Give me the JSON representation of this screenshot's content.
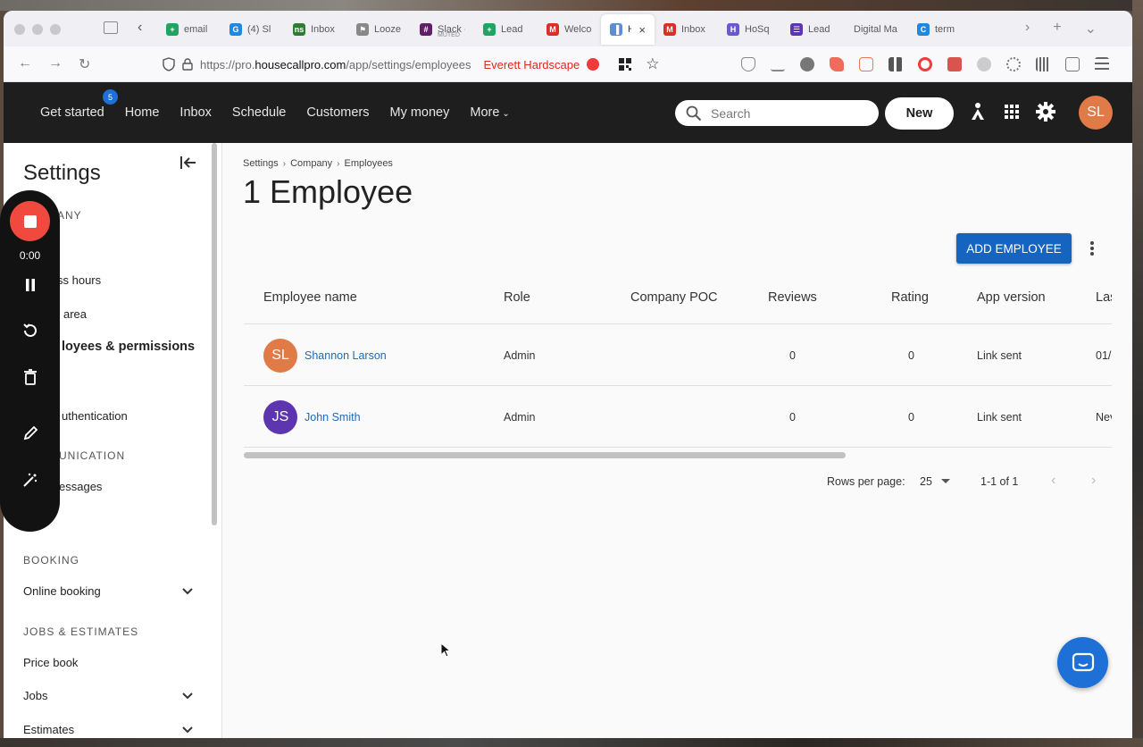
{
  "browser": {
    "tabs": [
      {
        "label": "email",
        "fav_color": "#1fa463",
        "fav_glyph": "+"
      },
      {
        "label": "(4) Sl",
        "fav_color": "#1e88e5",
        "fav_glyph": "G"
      },
      {
        "label": "Inbox",
        "fav_color": "#2e7d32",
        "fav_glyph": "ns"
      },
      {
        "label": "Looze",
        "fav_color": "#888888",
        "fav_glyph": "⚑"
      },
      {
        "label": "Slack -",
        "sublabel": "MUTED",
        "fav_color": "#611f69",
        "fav_glyph": "#"
      },
      {
        "label": "Lead",
        "fav_color": "#1fa463",
        "fav_glyph": "+"
      },
      {
        "label": "Welco",
        "fav_color": "#d93025",
        "fav_glyph": "M"
      },
      {
        "label": "Ho",
        "fav_color": "#5b8dd9",
        "fav_glyph": "▐"
      },
      {
        "label": "Inbox",
        "fav_color": "#d93025",
        "fav_glyph": "M"
      },
      {
        "label": "HoSq",
        "fav_color": "#6a5acd",
        "fav_glyph": "H"
      },
      {
        "label": "Lead",
        "fav_color": "#5e35b1",
        "fav_glyph": "☰"
      },
      {
        "label": "Digital Ma",
        "fav_color": "",
        "fav_glyph": ""
      },
      {
        "label": "term",
        "fav_color": "#1e88e5",
        "fav_glyph": "C"
      }
    ],
    "active_tab_index": 7,
    "url_prefix": "https://pro.",
    "url_domain": "housecallpro.com",
    "url_path": "/app/settings/employees",
    "extension_label": "Everett Hardscape"
  },
  "app": {
    "nav": [
      {
        "label": "Get started",
        "badge": "5"
      },
      {
        "label": "Home"
      },
      {
        "label": "Inbox"
      },
      {
        "label": "Schedule"
      },
      {
        "label": "Customers"
      },
      {
        "label": "My money"
      },
      {
        "label": "More"
      }
    ],
    "search_placeholder": "Search",
    "new_label": "New",
    "user_initials": "SL",
    "accent": "#1565c0",
    "avatar_color": "#e07a47"
  },
  "sidebar": {
    "title": "Settings",
    "sections": [
      {
        "label": "ANY"
      },
      {
        "label": "UNICATION"
      },
      {
        "label": "BOOKING"
      },
      {
        "label": "JOBS & ESTIMATES"
      }
    ],
    "items": [
      {
        "label": "ss hours"
      },
      {
        "label": "area"
      },
      {
        "label": "loyees & permissions"
      },
      {
        "label": "uthentication"
      },
      {
        "label": "essages"
      },
      {
        "label": "Online booking",
        "expandable": true
      },
      {
        "label": "Price book"
      },
      {
        "label": "Jobs",
        "expandable": true
      },
      {
        "label": "Estimates",
        "expandable": true
      }
    ]
  },
  "recorder": {
    "time": "0:00"
  },
  "main": {
    "breadcrumb": [
      "Settings",
      "Company",
      "Employees"
    ],
    "title": "1 Employee",
    "add_label": "ADD EMPLOYEE",
    "columns": [
      "Employee name",
      "Role",
      "Company POC",
      "Reviews",
      "Rating",
      "App version",
      "Las"
    ],
    "rows": [
      {
        "initials": "SL",
        "avatar_color": "#e07a47",
        "name": "Shannon Larson",
        "role": "Admin",
        "poc": "",
        "reviews": "0",
        "rating": "0",
        "app_version": "Link sent",
        "last": "01/"
      },
      {
        "initials": "JS",
        "avatar_color": "#5e35b1",
        "name": "John Smith",
        "role": "Admin",
        "poc": "",
        "reviews": "0",
        "rating": "0",
        "app_version": "Link sent",
        "last": "Nev"
      }
    ],
    "pagination": {
      "rows_per_page_label": "Rows per page:",
      "rows_per_page": "25",
      "range": "1-1 of 1"
    }
  }
}
